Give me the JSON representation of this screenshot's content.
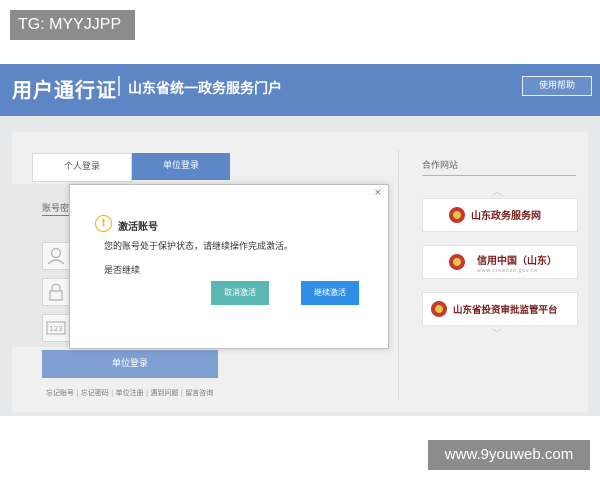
{
  "overlay_tag": "TG: MYYJJPP",
  "header": {
    "brand_main": "用户通行证",
    "brand_sub": "山东省统一政务服务门户",
    "help_button": "使用帮助"
  },
  "login": {
    "tabs": [
      "个人登录",
      "单位登录"
    ],
    "active_tab": "单位登录",
    "account_label": "账号密",
    "captcha_icon_text": "123",
    "submit": "单位登录",
    "links": [
      "忘记账号",
      "忘记密码",
      "单位注册",
      "遇到问题",
      "留言咨询"
    ]
  },
  "partners": {
    "title": "合作网站",
    "sites": [
      {
        "name": "山东政务服务网",
        "icon": "emblem-icon"
      },
      {
        "name": "信用中国（山东）",
        "url": "www.creditsd.gov.cn",
        "icon": "emblem-icon"
      },
      {
        "name": "山东省投资审批监管平台",
        "icon": "emblem-icon"
      }
    ]
  },
  "dialog": {
    "close": "×",
    "title": "激活账号",
    "message": "您的账号处于保护状态，请继续操作完成激活。",
    "confirm": "是否继续",
    "cancel": "取消激活",
    "continue": "继续激活",
    "icon": "warning-icon"
  },
  "watermark": "www.9youweb.com",
  "colors": {
    "header_blue": "#5f86c4",
    "tab_active": "#5d87c6",
    "cancel_teal": "#5bb7b3",
    "continue_blue": "#2f8fe6",
    "warning": "#f0b000"
  }
}
